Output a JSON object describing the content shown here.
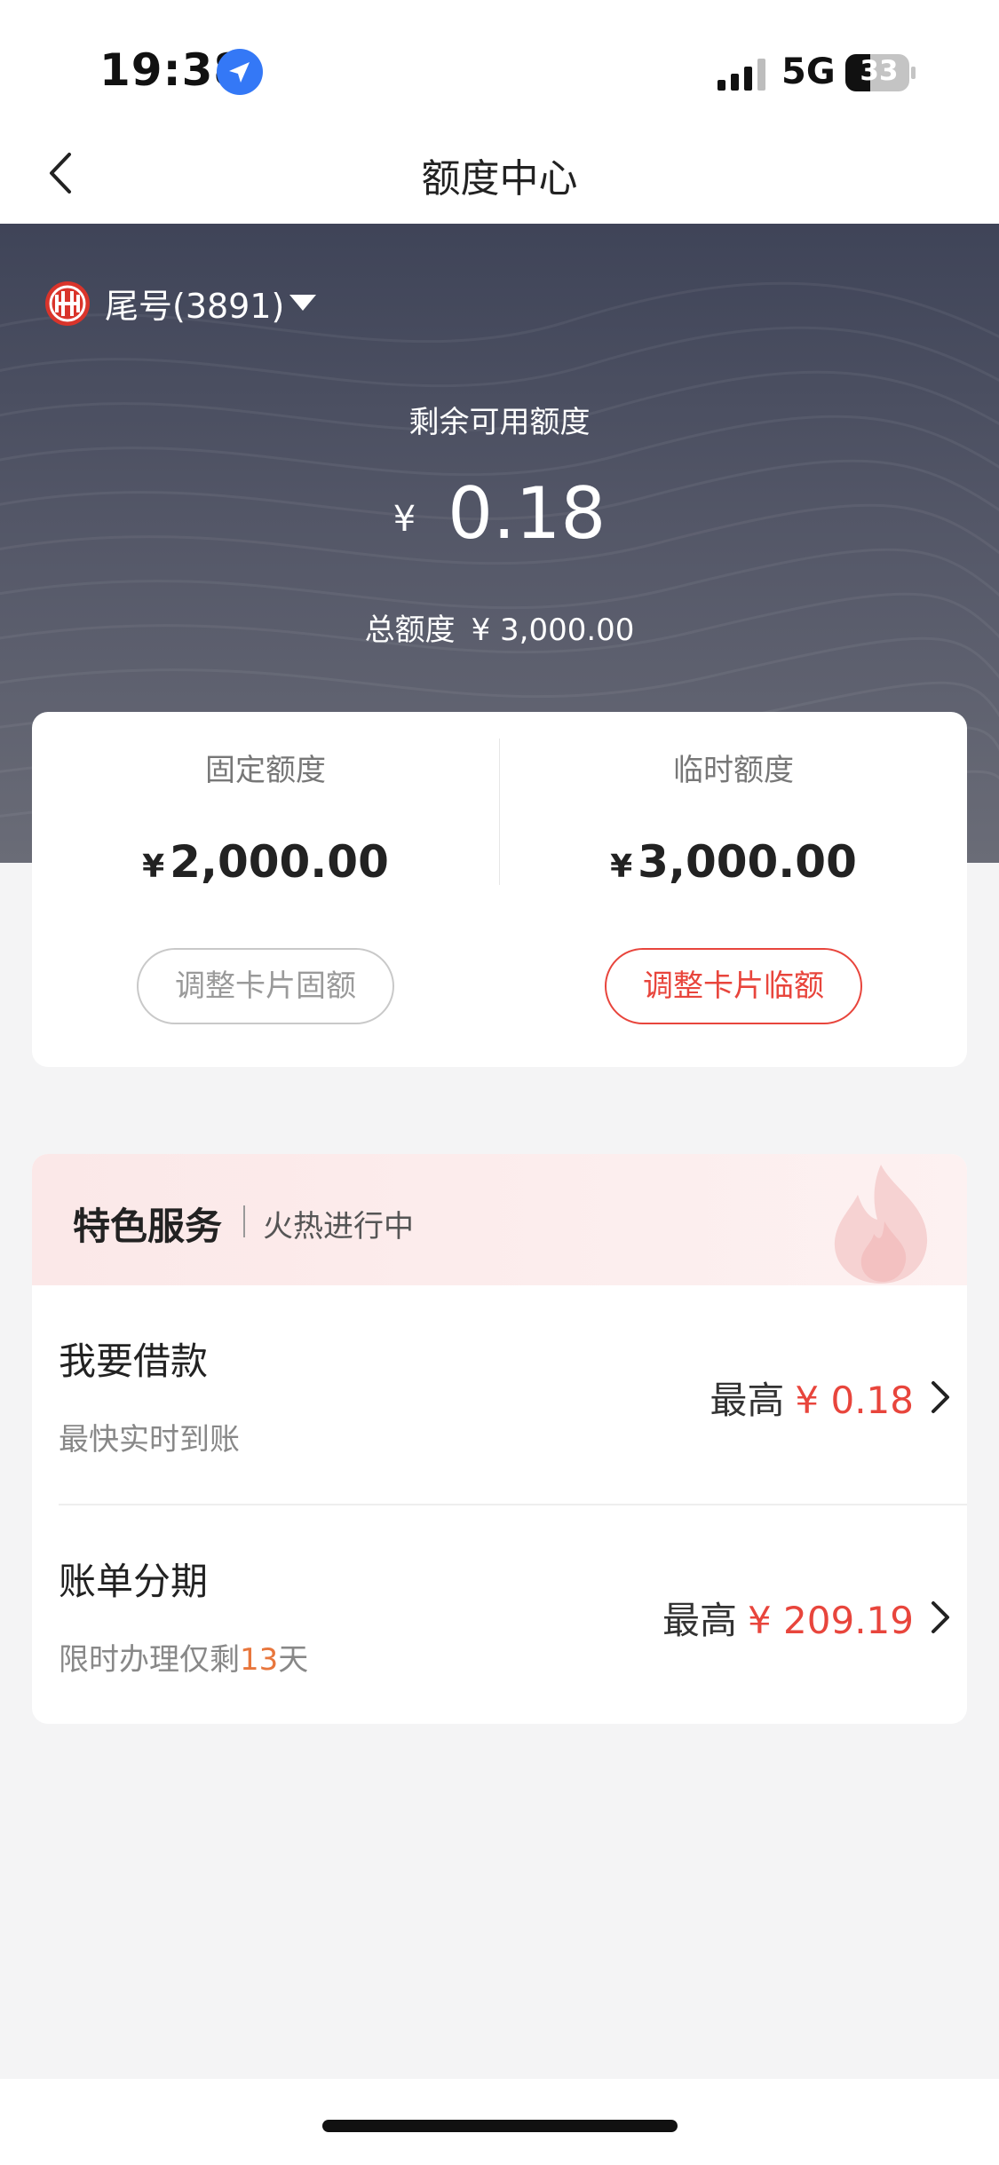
{
  "status_bar": {
    "time": "19:38",
    "network": "5G",
    "battery": "33",
    "icons": [
      "location-arrow-icon",
      "signal-bars-icon",
      "battery-icon"
    ]
  },
  "nav": {
    "title": "额度中心",
    "back_icon": "chevron-left-icon"
  },
  "hero": {
    "card_label": "尾号(3891)",
    "available_label": "剩余可用额度",
    "currency": "¥",
    "available_amount": "0.18",
    "total_label": "总额度",
    "total_amount": "¥ 3,000.00"
  },
  "limits": {
    "fixed": {
      "label": "固定额度",
      "currency": "¥",
      "amount": "2,000.00",
      "button": "调整卡片固额"
    },
    "temporary": {
      "label": "临时额度",
      "currency": "¥",
      "amount": "3,000.00",
      "button": "调整卡片临额"
    }
  },
  "services": {
    "title": "特色服务",
    "subtitle": "火热进行中",
    "items": [
      {
        "name": "我要借款",
        "desc": "最快实时到账",
        "max_label": "最高",
        "max_amount": "¥ 0.18"
      },
      {
        "name": "账单分期",
        "desc_prefix": "限时办理仅剩",
        "desc_days": "13",
        "desc_suffix": "天",
        "max_label": "最高",
        "max_amount": "¥ 209.19"
      }
    ]
  },
  "colors": {
    "accent_red": "#e8453c",
    "highlight_orange": "#e8763c",
    "hero_bg": "#4a4d5f",
    "page_bg": "#f4f4f5"
  }
}
